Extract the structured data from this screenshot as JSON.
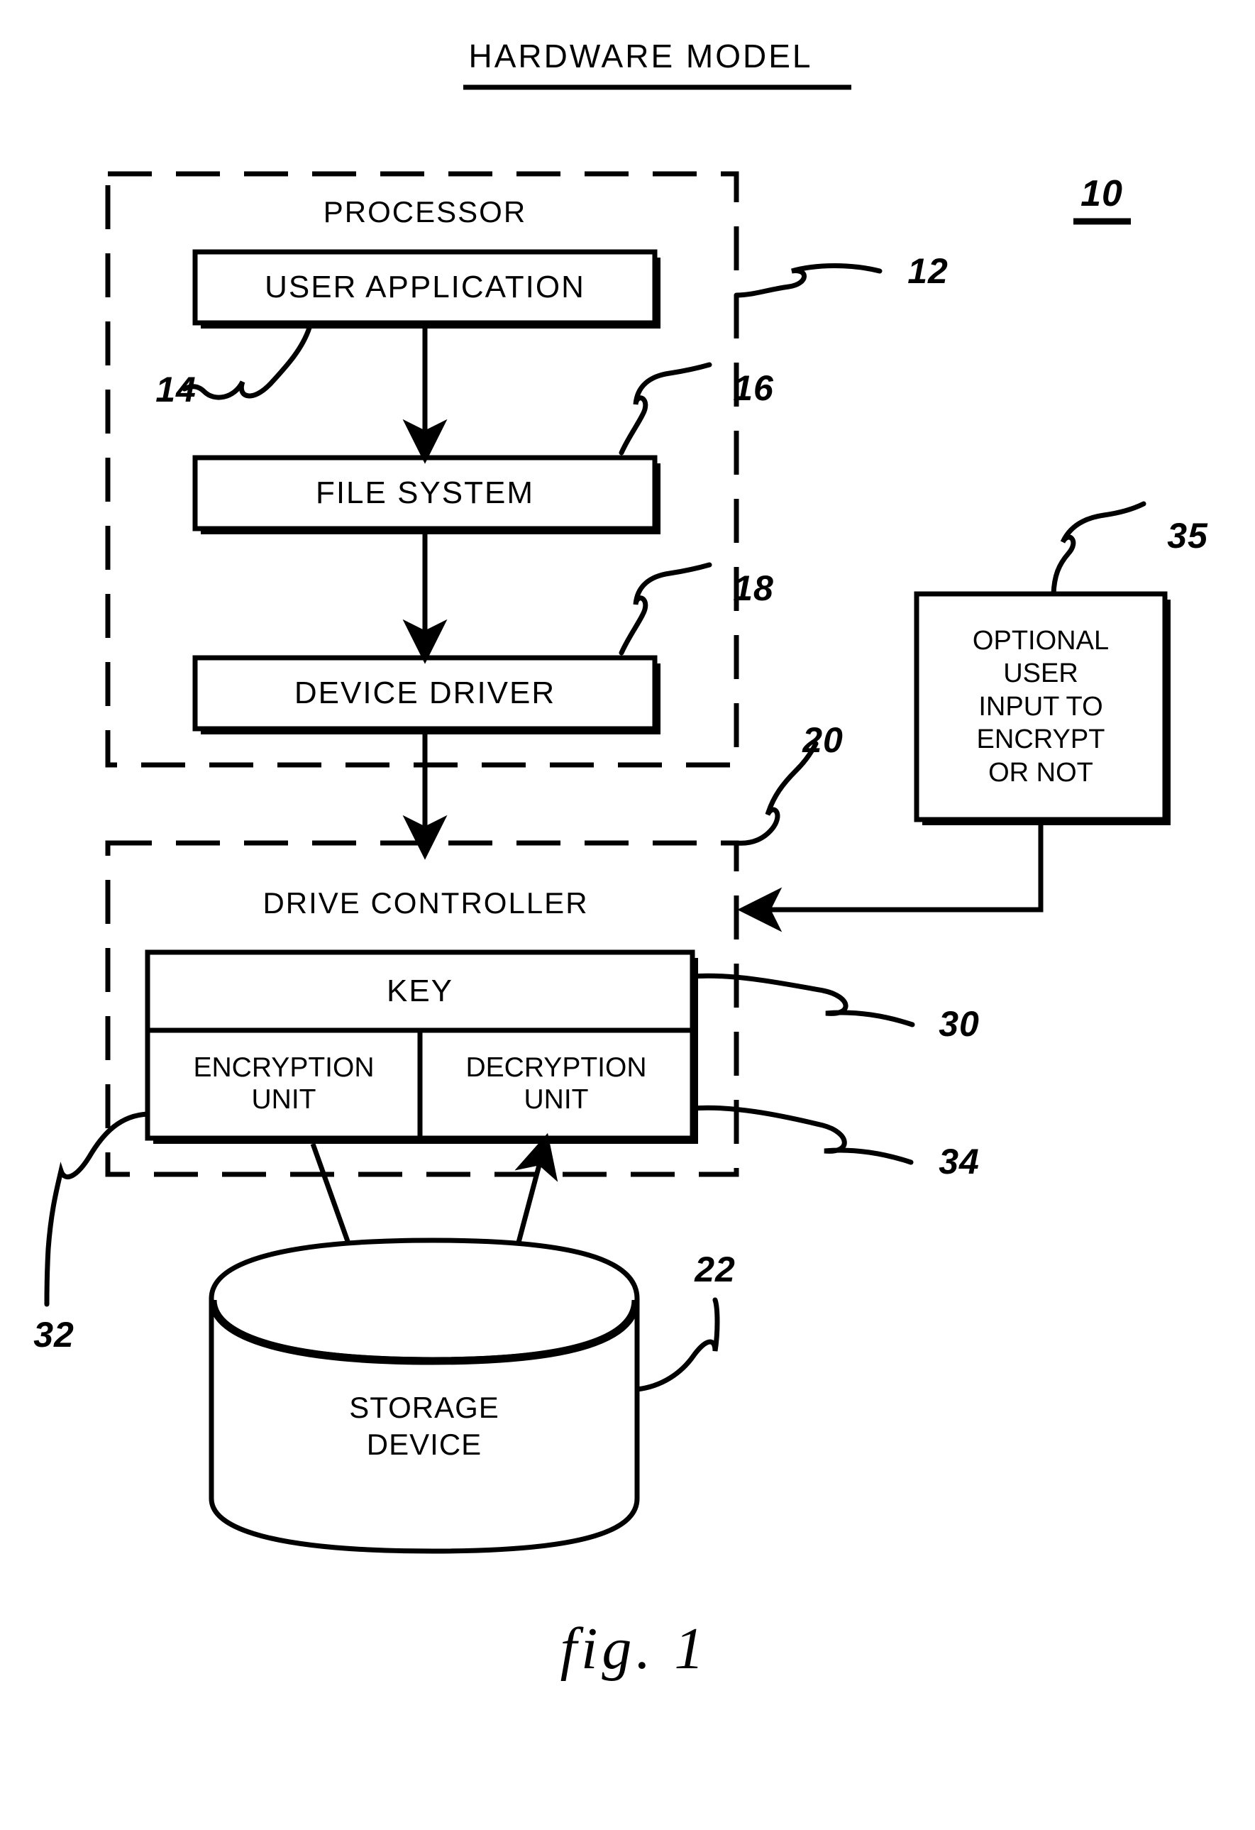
{
  "figure": {
    "title": "HARDWARE MODEL",
    "caption": "fig. 1",
    "overall_ref": "10"
  },
  "processor_group": {
    "label": "PROCESSOR",
    "ref": "12",
    "blocks": [
      {
        "id": "user-application",
        "label": "USER APPLICATION",
        "ref": "14"
      },
      {
        "id": "file-system",
        "label": "FILE SYSTEM",
        "ref": "16"
      },
      {
        "id": "device-driver",
        "label": "DEVICE DRIVER",
        "ref": "18"
      }
    ]
  },
  "drive_controller_group": {
    "label": "DRIVE CONTROLLER",
    "ref": "20",
    "key_block": {
      "label": "KEY",
      "ref": "30"
    },
    "units": [
      {
        "id": "encryption-unit",
        "label": "ENCRYPTION\nUNIT",
        "ref": "32"
      },
      {
        "id": "decryption-unit",
        "label": "DECRYPTION\nUNIT",
        "ref": "34"
      }
    ]
  },
  "optional_input_block": {
    "label": "OPTIONAL\nUSER\nINPUT TO\nENCRYPT\nOR NOT",
    "ref": "35"
  },
  "storage_device": {
    "label": "STORAGE\nDEVICE",
    "ref": "22"
  },
  "colors": {
    "ink": "#000000",
    "paper": "#ffffff"
  }
}
